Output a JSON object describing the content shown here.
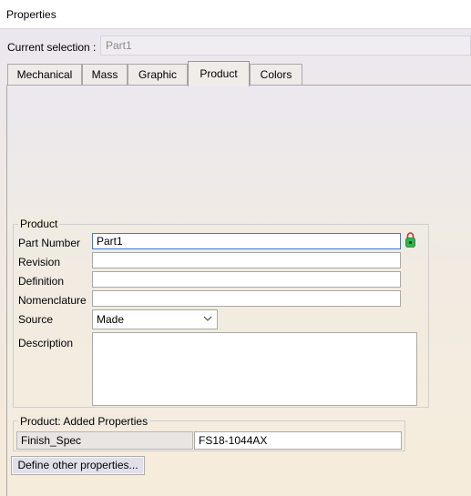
{
  "window": {
    "title": "Properties"
  },
  "current_selection": {
    "label": "Current selection :",
    "value": "Part1"
  },
  "tabs": [
    {
      "label": "Mechanical",
      "active": false
    },
    {
      "label": "Mass",
      "active": false
    },
    {
      "label": "Graphic",
      "active": false
    },
    {
      "label": "Product",
      "active": true
    },
    {
      "label": "Colors",
      "active": false
    }
  ],
  "product": {
    "legend": "Product",
    "part_number": {
      "label": "Part Number",
      "value": "Part1"
    },
    "revision": {
      "label": "Revision",
      "value": ""
    },
    "definition": {
      "label": "Definition",
      "value": ""
    },
    "nomenclature": {
      "label": "Nomenclature",
      "value": ""
    },
    "source": {
      "label": "Source",
      "value": "Made"
    },
    "description": {
      "label": "Description",
      "value": ""
    },
    "lock_icon": "padlock-icon"
  },
  "added_properties": {
    "legend": "Product: Added Properties",
    "rows": [
      {
        "name": "Finish_Spec",
        "value": "FS18-1044AX"
      }
    ]
  },
  "buttons": {
    "define_other": "Define other properties..."
  },
  "colors": {
    "focus_border": "#3a7bd5",
    "lock_green": "#2db54a",
    "lock_red": "#c0392b"
  }
}
